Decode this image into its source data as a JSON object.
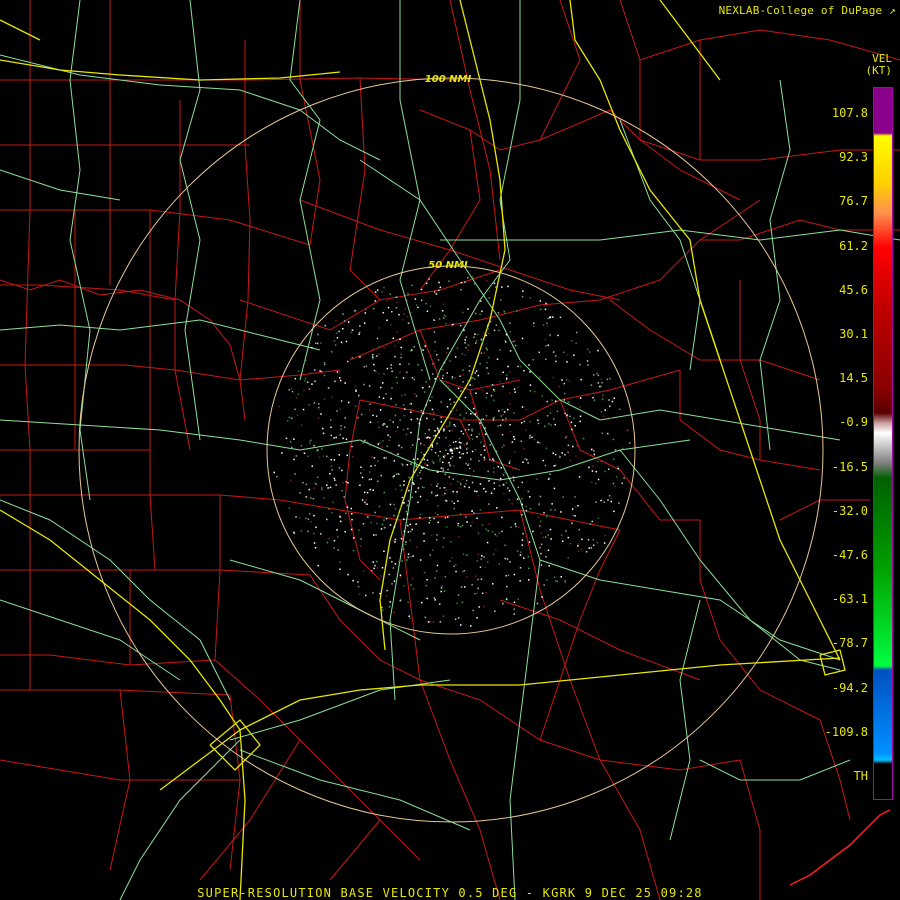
{
  "header": {
    "credit": "NEXLAB-College of DuPage"
  },
  "legend": {
    "title": "VEL",
    "unit": "(KT)",
    "ticks": [
      "107.8",
      "92.3",
      "76.7",
      "61.2",
      "45.6",
      "30.1",
      "14.5",
      "-0.9",
      "-16.5",
      "-32.0",
      "-47.6",
      "-63.1",
      "-78.7",
      "-94.2",
      "-109.8",
      "TH"
    ]
  },
  "rings": {
    "inner_label": "50 NMI",
    "outer_label": "100 NMI"
  },
  "colors": {
    "counties": "#c81818",
    "highways_green": "#8ce09a",
    "interstates_yellow": "#e8e800",
    "rings": "#e8c896",
    "coast": "#ff2020"
  },
  "footer": {
    "caption": "SUPER-RESOLUTION BASE VELOCITY 0.5 DEG - KGRK 9 DEC 25 09:28"
  }
}
